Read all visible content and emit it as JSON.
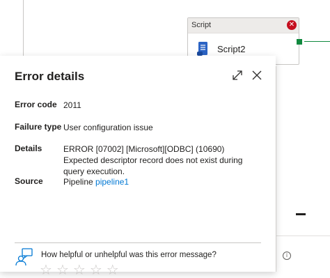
{
  "canvas": {
    "activity": {
      "header": "Script",
      "name": "Script2",
      "error_glyph": "✕",
      "icon": "script-scroll-icon"
    },
    "info_glyph": "i"
  },
  "error_panel": {
    "title": "Error details",
    "expand_icon": "expand-icon",
    "close_icon": "close-icon",
    "rows": [
      {
        "label": "Error code",
        "value": "2011"
      },
      {
        "label": "Failure type",
        "value": "User configuration issue"
      },
      {
        "label": "Details",
        "value": "ERROR [07002] [Microsoft][ODBC] (10690) Expected descriptor record does not exist during query execution."
      },
      {
        "label": "Source",
        "value_prefix": "Pipeline",
        "link": "pipeline1"
      }
    ],
    "feedback": {
      "question": "How helpful or unhelpful was this error message?",
      "rating": 0,
      "max_rating": 5
    }
  },
  "colors": {
    "error_red": "#c50f1f",
    "success_green": "#10893e",
    "link_blue": "#0078d4",
    "script_icon_blue": "#2b63c4"
  }
}
